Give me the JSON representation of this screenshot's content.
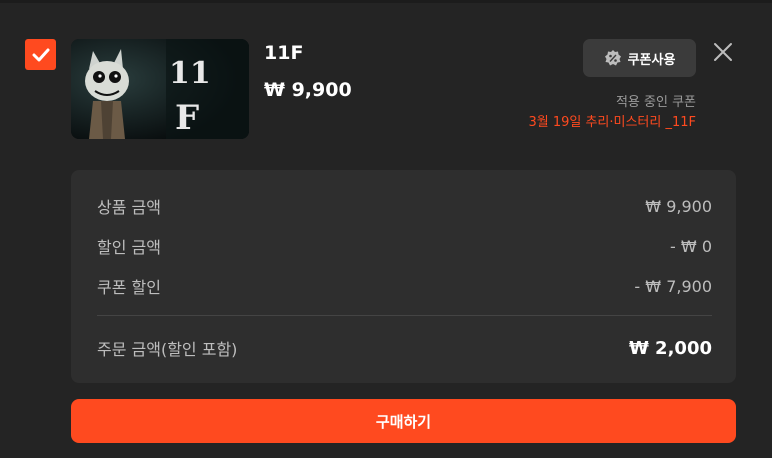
{
  "product": {
    "checked": true,
    "title": "11F",
    "price": "₩ 9,900",
    "thumbnail_text": "11F"
  },
  "coupon": {
    "button_label": "쿠폰사용",
    "applied_label": "적용 중인 쿠폰",
    "applied_name": "3월 19일 추리·미스터리 _11F"
  },
  "summary": {
    "rows": [
      {
        "label": "상품 금액",
        "value": "₩ 9,900"
      },
      {
        "label": "할인 금액",
        "value": "- ₩ 0"
      },
      {
        "label": "쿠폰 할인",
        "value": "- ₩ 7,900"
      }
    ],
    "total_label": "주문 금액(할인 포함)",
    "total_value": "₩ 2,000"
  },
  "actions": {
    "buy_label": "구매하기"
  },
  "colors": {
    "accent": "#ff4a1f",
    "background": "#242424",
    "box": "#2e2e2e"
  }
}
